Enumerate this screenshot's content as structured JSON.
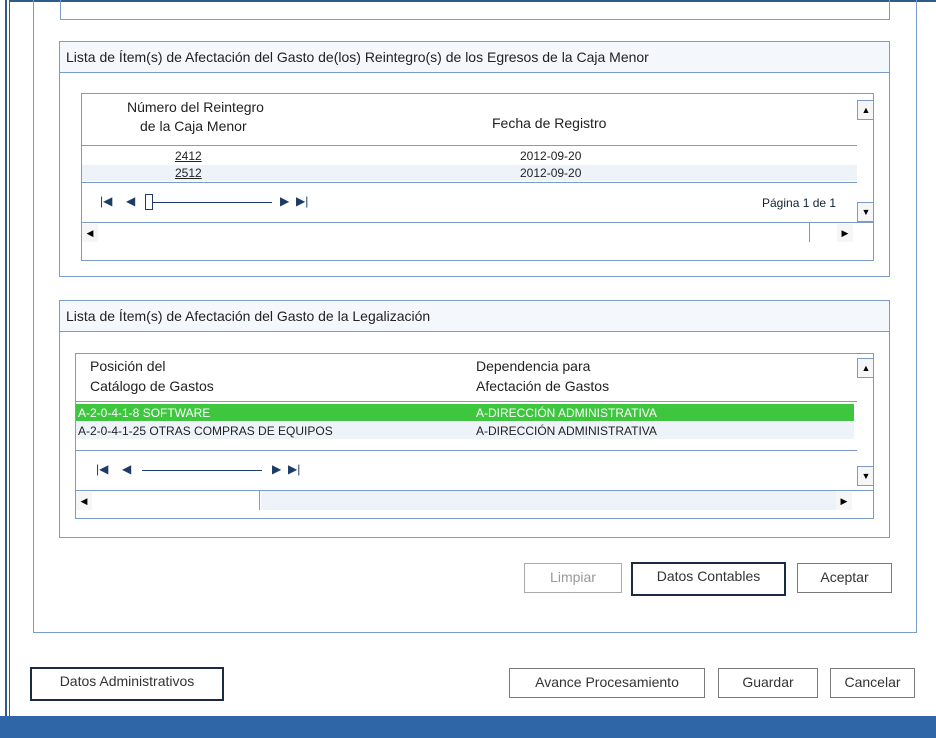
{
  "panel1": {
    "title": "Lista de Ítem(s) de Afectación del Gasto de(los) Reintegro(s) de los Egresos de la Caja Menor",
    "col1_line1": "Número del Reintegro",
    "col1_line2": "de la Caja Menor",
    "col2": "Fecha de Registro",
    "rows": [
      {
        "num": "2412",
        "fecha": "2012-09-20"
      },
      {
        "num": "2512",
        "fecha": "2012-09-20"
      }
    ],
    "page_text": "Página 1 de 1"
  },
  "panel2": {
    "title": "Lista de Ítem(s) de Afectación del Gasto de la Legalización",
    "col1_line1": "Posición del",
    "col1_line2": "Catálogo de Gastos",
    "col2_line1": "Dependencia para",
    "col2_line2": "Afectación de Gastos",
    "rows": [
      {
        "pos": "A-2-0-4-1-8 SOFTWARE",
        "dep": "A-DIRECCIÓN ADMINISTRATIVA",
        "selected": true
      },
      {
        "pos": "A-2-0-4-1-25 OTRAS COMPRAS DE EQUIPOS",
        "dep": "A-DIRECCIÓN ADMINISTRATIVA",
        "selected": false
      }
    ]
  },
  "actions": {
    "limpiar": "Limpiar",
    "datos_contables": "Datos Contables",
    "aceptar": "Aceptar"
  },
  "footer": {
    "datos_administrativos": "Datos Administrativos",
    "avance": "Avance Procesamiento",
    "guardar": "Guardar",
    "cancelar": "Cancelar"
  },
  "colors": {
    "selected_row": "#3ec63e",
    "border": "#7a9cc6",
    "frame": "#2e66a8"
  }
}
